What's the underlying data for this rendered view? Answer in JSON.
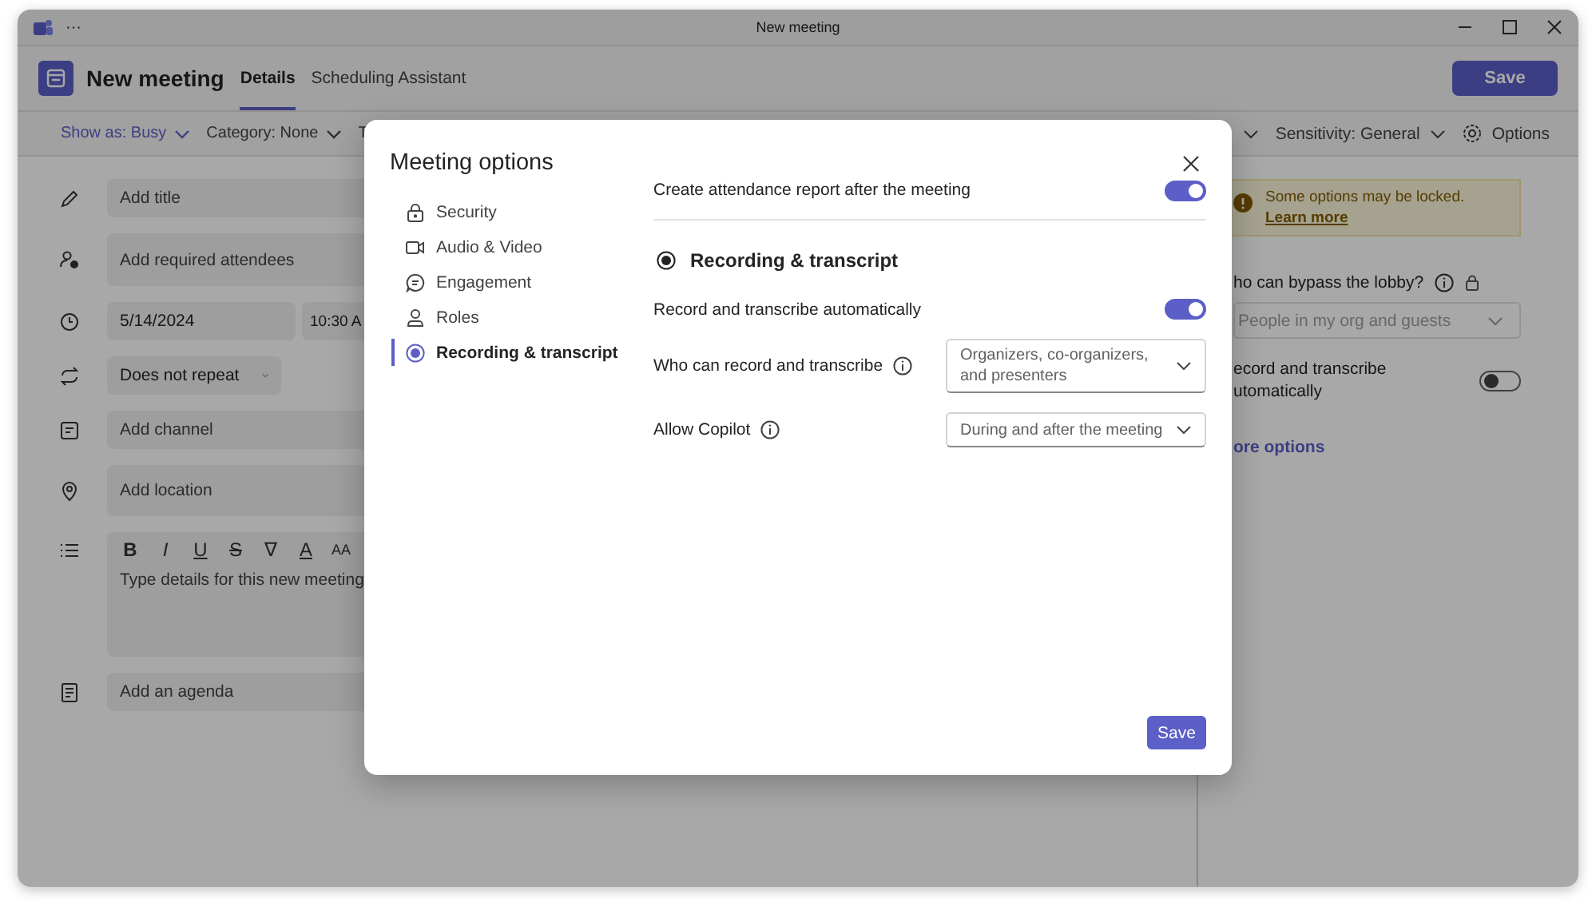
{
  "window": {
    "title": "New meeting",
    "menu": "···"
  },
  "header": {
    "title": "New meeting",
    "tabs": [
      {
        "label": "Details",
        "selected": true
      },
      {
        "label": "Scheduling Assistant",
        "selected": false
      }
    ],
    "save": "Save"
  },
  "toolbar": {
    "left": [
      {
        "label": "Show as: Busy",
        "highlighted": true,
        "dropdown": true
      },
      {
        "label": "Category: None",
        "highlighted": false,
        "dropdown": true
      },
      {
        "label": "T",
        "highlighted": false,
        "dropdown": false
      }
    ],
    "sensitivity": "Sensitivity: General",
    "options": "Options"
  },
  "form": [
    {
      "kind": "field",
      "placeholder": "Add title"
    },
    {
      "kind": "field",
      "placeholder": "Add required attendees"
    },
    {
      "kind": "datetime",
      "values": [
        "5/14/2024",
        "10:30 A"
      ]
    },
    {
      "kind": "select",
      "value": "Does not repeat"
    },
    {
      "kind": "field",
      "placeholder": "Add channel"
    },
    {
      "kind": "field",
      "placeholder": "Add location"
    },
    {
      "kind": "editor",
      "buttons": [
        "B",
        "I",
        "U",
        "S",
        "∇",
        "A",
        "AA"
      ],
      "placeholder": "Type details for this new meeting"
    },
    {
      "kind": "field",
      "placeholder": "Add an agenda"
    }
  ],
  "side_panel": {
    "notice": "Some options may be locked.",
    "notice_link": "Learn more",
    "lobby_label": "ho can bypass the lobby?",
    "lobby_value": "People in my org and guests",
    "record_label": "ecord and transcribe utomatically",
    "record_on": false,
    "more_link": "ore options"
  },
  "dialog": {
    "title": "Meeting options",
    "nav": [
      {
        "label": "Security",
        "selected": false
      },
      {
        "label": "Audio & Video",
        "selected": false
      },
      {
        "label": "Engagement",
        "selected": false
      },
      {
        "label": "Roles",
        "selected": false
      },
      {
        "label": "Recording & transcript",
        "selected": true
      }
    ],
    "top_setting": {
      "label": "Create attendance report after the meeting",
      "on": true
    },
    "section": "Recording & transcript",
    "settings": [
      {
        "kind": "toggle",
        "label": "Record and transcribe automatically",
        "on": true
      },
      {
        "kind": "select",
        "label": "Who can record and transcribe",
        "value": "Organizers, co-organizers, and presenters"
      },
      {
        "kind": "select",
        "label": "Allow Copilot",
        "value": "During and after the meeting"
      }
    ],
    "save": "Save"
  }
}
